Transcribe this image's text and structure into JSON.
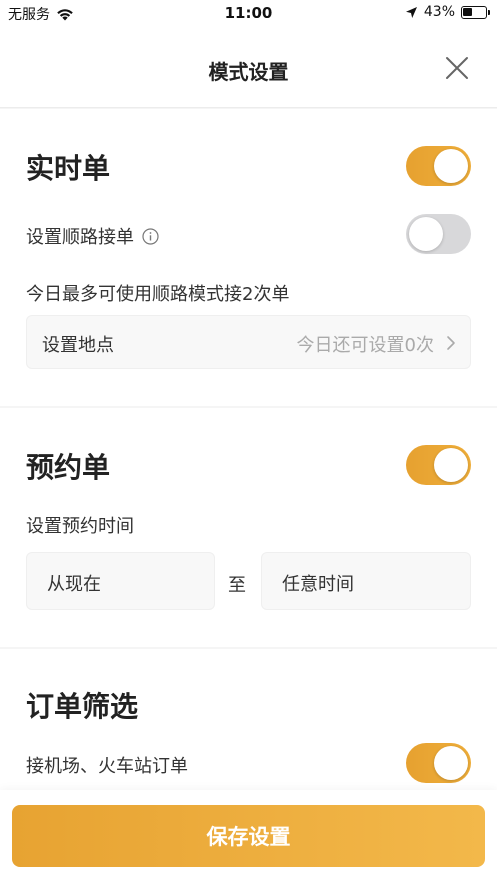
{
  "status_bar": {
    "carrier": "无服务",
    "time": "11:00",
    "battery": "43%",
    "battery_level": 0.43
  },
  "nav": {
    "title": "模式设置"
  },
  "realtime": {
    "title": "实时单",
    "enabled": true,
    "route_label": "设置顺路接单",
    "route_enabled": false,
    "route_note": "今日最多可使用顺路模式接2次单",
    "location_label": "设置地点",
    "location_value": "今日还可设置0次"
  },
  "reserve": {
    "title": "预约单",
    "enabled": true,
    "time_label": "设置预约时间",
    "from": "从现在",
    "to_text": "至",
    "until": "任意时间"
  },
  "filter": {
    "title": "订单筛选",
    "airport_label": "接机场、火车站订单",
    "airport_enabled": true
  },
  "save": {
    "label": "保存设置"
  },
  "colors": {
    "accent": "#E9A536",
    "toggle_off": "#D8D8DA",
    "background": "#F5F5F5"
  }
}
